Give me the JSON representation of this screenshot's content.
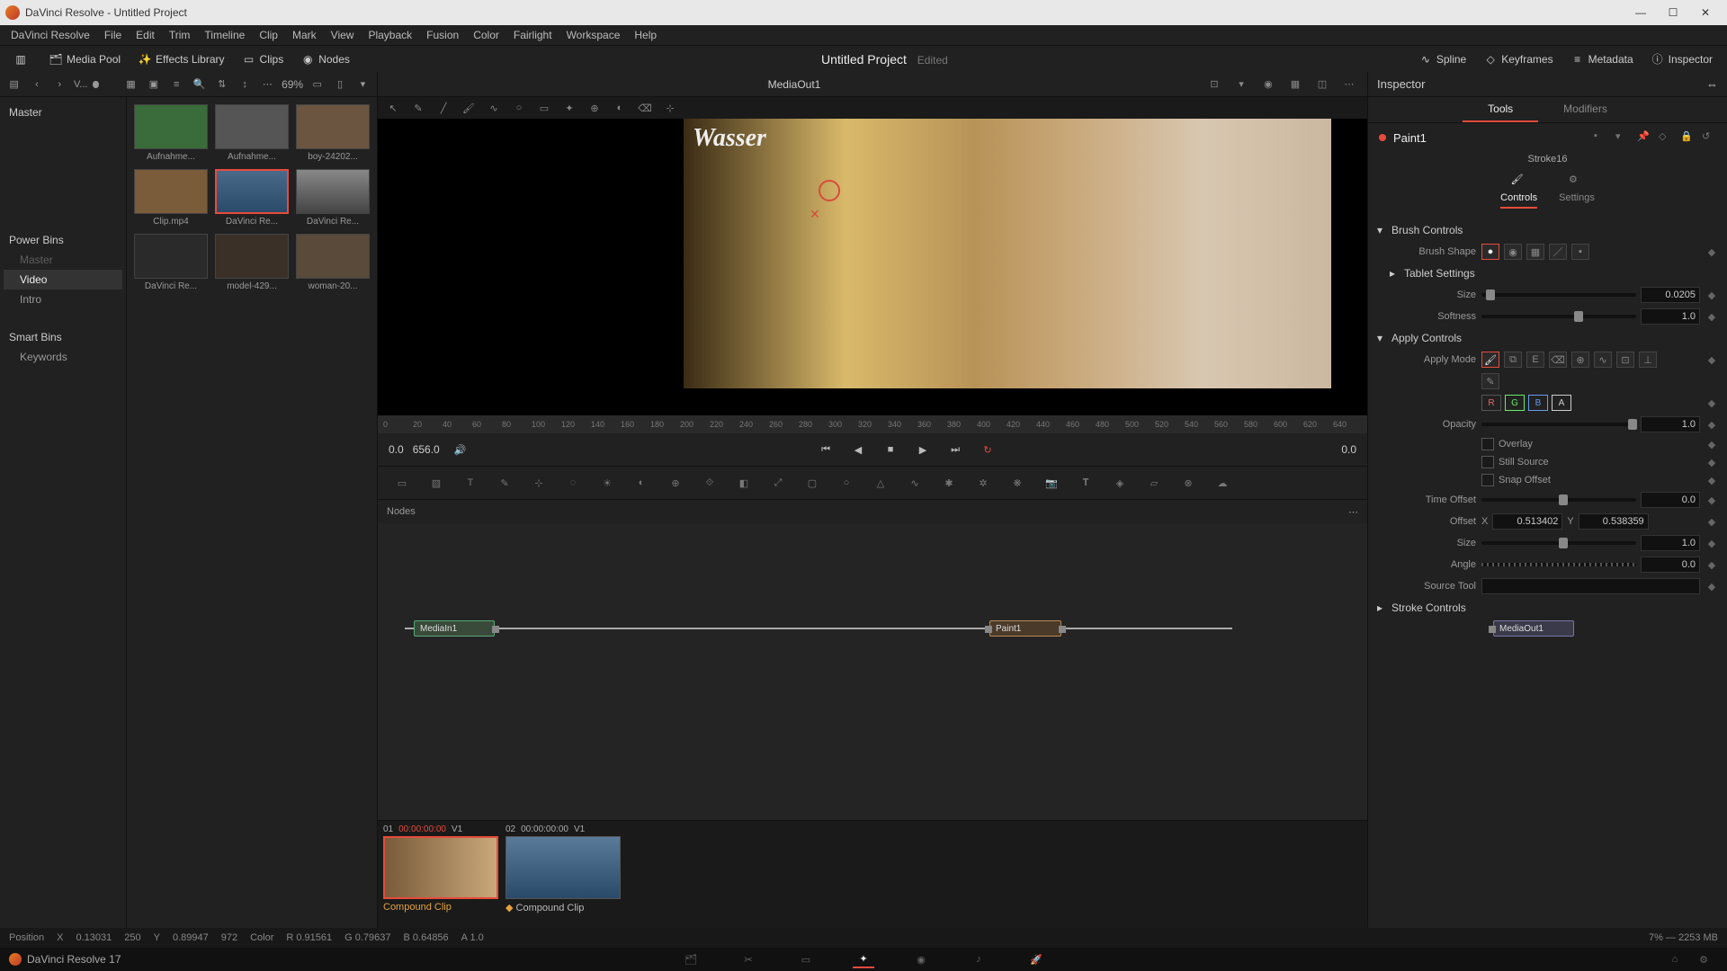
{
  "title_bar": "DaVinci Resolve - Untitled Project",
  "menu": [
    "DaVinci Resolve",
    "File",
    "Edit",
    "Trim",
    "Timeline",
    "Clip",
    "Mark",
    "View",
    "Playback",
    "Fusion",
    "Color",
    "Fairlight",
    "Workspace",
    "Help"
  ],
  "workspace_buttons": {
    "media_pool": "Media Pool",
    "effects": "Effects Library",
    "clips": "Clips",
    "nodes": "Nodes",
    "spline": "Spline",
    "keyframes": "Keyframes",
    "metadata": "Metadata",
    "inspector": "Inspector"
  },
  "project_title": "Untitled Project",
  "project_edited": "Edited",
  "media_pool": {
    "view_label": "V...",
    "zoom": "69%",
    "tree": {
      "master": "Master",
      "power_bins": "Power Bins",
      "power_items": [
        "Master",
        "Video",
        "Intro"
      ],
      "smart_bins": "Smart Bins",
      "smart_items": [
        "Keywords"
      ]
    },
    "clips": [
      {
        "label": "Aufnahme..."
      },
      {
        "label": "Aufnahme..."
      },
      {
        "label": "boy-24202..."
      },
      {
        "label": "Clip.mp4"
      },
      {
        "label": "DaVinci Re..."
      },
      {
        "label": "DaVinci Re..."
      },
      {
        "label": "DaVinci Re..."
      },
      {
        "label": "model-429..."
      },
      {
        "label": "woman-20..."
      }
    ]
  },
  "viewer": {
    "label": "MediaOut1",
    "watermark": "Wasser",
    "ruler_start": 0,
    "ruler_ticks": [
      "0",
      "20",
      "40",
      "60",
      "80",
      "100",
      "120",
      "140",
      "160",
      "180",
      "200",
      "220",
      "240",
      "260",
      "280",
      "300",
      "320",
      "340",
      "360",
      "380",
      "400",
      "420",
      "440",
      "460",
      "480",
      "500",
      "520",
      "540",
      "560",
      "580",
      "600",
      "620",
      "640"
    ],
    "time_start": "0.0",
    "time_end": "656.0",
    "time_right": "0.0"
  },
  "nodes_header": "Nodes",
  "flow_nodes": {
    "in": "MediaIn1",
    "paint": "Paint1",
    "out": "MediaOut1"
  },
  "clip_items": [
    {
      "idx": "01",
      "tc": "00:00:00:00",
      "trk": "V1",
      "label": "Compound Clip"
    },
    {
      "idx": "02",
      "tc": "00:00:00:00",
      "trk": "V1",
      "label": "Compound Clip"
    }
  ],
  "inspector": {
    "header": "Inspector",
    "tabs": {
      "tools": "Tools",
      "modifiers": "Modifiers"
    },
    "node_name": "Paint1",
    "stroke": "Stroke16",
    "subtabs": {
      "controls": "Controls",
      "settings": "Settings"
    },
    "sections": {
      "brush": "Brush Controls",
      "brush_shape": "Brush Shape",
      "tablet": "Tablet Settings",
      "size": "Size",
      "size_val": "0.0205",
      "softness": "Softness",
      "softness_val": "1.0",
      "apply": "Apply Controls",
      "apply_mode": "Apply Mode",
      "channels": {
        "r": "R",
        "g": "G",
        "b": "B",
        "a": "A"
      },
      "opacity": "Opacity",
      "opacity_val": "1.0",
      "overlay": "Overlay",
      "still": "Still Source",
      "snap": "Snap Offset",
      "time_offset": "Time Offset",
      "time_offset_val": "0.0",
      "offset": "Offset",
      "offset_x": "0.513402",
      "offset_y": "0.538359",
      "x": "X",
      "y": "Y",
      "isize": "Size",
      "isize_val": "1.0",
      "angle": "Angle",
      "angle_val": "0.0",
      "source_tool": "Source Tool",
      "stroke_controls": "Stroke Controls"
    }
  },
  "status": {
    "pos_label": "Position",
    "pos_x_l": "X",
    "pos_x": "0.13031",
    "pos_xp": "250",
    "pos_y_l": "Y",
    "pos_y": "0.89947",
    "pos_yp": "972",
    "col_label": "Color",
    "col_r": "R 0.91561",
    "col_g": "G 0.79637",
    "col_b": "B 0.64856",
    "col_a": "A 1.0",
    "mem": "7% — 2253 MB"
  },
  "app_name": "DaVinci Resolve 17"
}
